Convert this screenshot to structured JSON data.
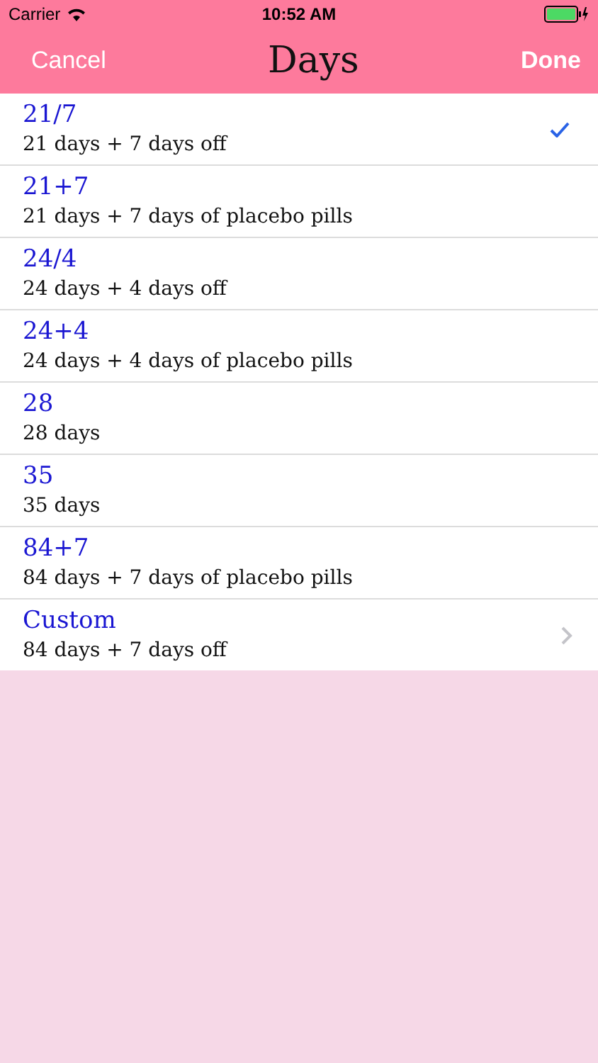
{
  "status_bar": {
    "carrier": "Carrier",
    "time": "10:52 AM"
  },
  "nav_bar": {
    "cancel": "Cancel",
    "title": "Days",
    "done": "Done"
  },
  "options": [
    {
      "kind": "option",
      "title": "21/7",
      "detail": "21 days + 7 days off",
      "selected": true
    },
    {
      "kind": "option",
      "title": "21+7",
      "detail": "21 days + 7 days of placebo pills",
      "selected": false
    },
    {
      "kind": "option",
      "title": "24/4",
      "detail": "24 days + 4 days off",
      "selected": false
    },
    {
      "kind": "option",
      "title": "24+4",
      "detail": "24 days + 4 days of placebo pills",
      "selected": false
    },
    {
      "kind": "option",
      "title": "28",
      "detail": "28 days",
      "selected": false
    },
    {
      "kind": "option",
      "title": "35",
      "detail": "35 days",
      "selected": false
    },
    {
      "kind": "option",
      "title": "84+7",
      "detail": "84 days + 7 days of placebo pills",
      "selected": false
    },
    {
      "kind": "disclosure",
      "title": "Custom",
      "detail": "84 days + 7 days off",
      "selected": false
    }
  ]
}
